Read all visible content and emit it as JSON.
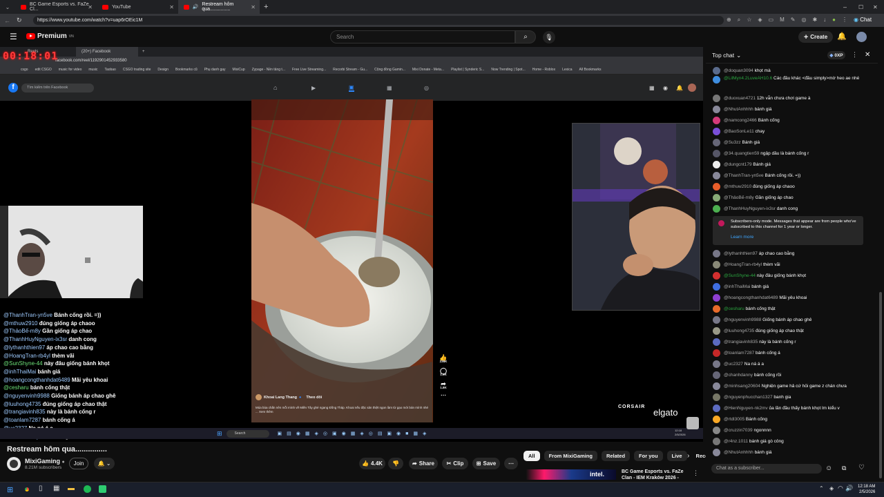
{
  "browser": {
    "tabs": [
      {
        "label": "BC Game Esports vs. FaZe Cl...",
        "active": false
      },
      {
        "label": "YouTube",
        "active": false
      },
      {
        "label": "Restream hôm qua...............",
        "active": true
      }
    ],
    "url": "https://www.youtube.com/watch?v=uap6rOEic1M",
    "chat_ext": "Chat"
  },
  "header": {
    "logo": "Premium",
    "logo_sup": "VN",
    "search_placeholder": "Search",
    "create_label": "Create"
  },
  "stream": {
    "timer": "00:18:01",
    "fb_tab1": "Reels",
    "fb_tab2": "(20+) Facebook",
    "fb_url": "facebook.com/reel/1192901452933580",
    "fb_search": "Tìm kiếm trên Facebook",
    "bookmarks": [
      "csgo",
      "edit CSGO",
      "music for video",
      "music",
      "Taobao",
      "CSGO trading site",
      "Design",
      "Bookmarks cũ",
      "Phụ danh gay",
      "MixiCup",
      "Zypage - Nền tảng t...",
      "Free Live Streaming...",
      "Recorbi Stream - Gu...",
      "Cộng đồng Gamin...",
      "Mixi Donate - Meta...",
      "Playlist | Synderic S...",
      "Now Trending | Spot...",
      "Home - Roblox",
      "Lexica",
      "All Bookmarks"
    ],
    "reel_author": "Khoai Lang Thang",
    "reel_follow": "Theo dõi",
    "reel_caption": "Múa bùa chấn nên mỗi mình về Miền Tây ghé ngang Đồng Tháp. Khoai nếu đặc sản thiệt ngon làm từ gạo mới bán mình nhé ... Xem thêm",
    "reel_likes": "236K",
    "reel_comments": "1.9K",
    "reel_shares": "1.8K",
    "corsair": "CORSAIR",
    "elgato": "elgato",
    "inner_search": "Search",
    "inner_clock_time": "12:18",
    "inner_clock_date": "2/5/2026",
    "overlay_chat": [
      {
        "user": "@ThanhTran-yn5ve",
        "msg": "Bánh cống rồi. =))",
        "green": false
      },
      {
        "user": "@mthuw2910",
        "msg": "đúng giống áp chaoo",
        "green": false
      },
      {
        "user": "@ThảoBế-m8y",
        "msg": "Gần giống áp chao",
        "green": false
      },
      {
        "user": "@ThanhHuyNguyen-ix3sr",
        "msg": "danh cong",
        "green": false
      },
      {
        "user": "@lythanhthien97",
        "msg": "áp chao cao bằng",
        "green": false
      },
      {
        "user": "@HoangTran-rb4yl",
        "msg": "thèm vãi",
        "green": false
      },
      {
        "user": "@SunShyne-44",
        "msg": "này đâu giống bánh khọt",
        "green": true
      },
      {
        "user": "@inhThaiMai",
        "msg": "bánh giá",
        "green": false
      },
      {
        "user": "@hoangcongthanhdat6489",
        "msg": "Mãi yêu khoai",
        "green": false
      },
      {
        "user": "@cesharu",
        "msg": "bánh cống thật",
        "green": true
      },
      {
        "user": "@nguyenvinh9988",
        "msg": "Giống bánh áp chao ghê",
        "green": false
      },
      {
        "user": "@luuhong4735",
        "msg": "đúng giống áp chao thật",
        "green": false
      },
      {
        "user": "@trangiavinh835",
        "msg": "này là bánh cống r",
        "green": false
      },
      {
        "user": "@toanlam7287",
        "msg": "bánh cống á",
        "green": false
      },
      {
        "user": "@uc2327",
        "msg": "Na ná á a",
        "green": false
      },
      {
        "user": "@chanhdanny",
        "msg": "bánh cống rồi",
        "green": false
      }
    ]
  },
  "video": {
    "title": "Restream hôm qua...............",
    "channel": "MixiGaming",
    "subscribers": "8.21M subscribers",
    "join": "Join",
    "likes": "4.4K",
    "share": "Share",
    "clip": "Clip",
    "save": "Save",
    "chips": [
      "All",
      "From MixiGaming",
      "Related",
      "For you",
      "Live",
      "Rece"
    ],
    "rec_title": "BC Game Esports vs. FaZe Clan - IEM Kraków 2026 -"
  },
  "chat": {
    "header": "Top chat",
    "points": "0XP",
    "input_placeholder": "Chat as a subscriber...",
    "notice_text": "Subscribers-only mode. Messages that appear are from people who've subscribed to this channel for 1 year or longer.",
    "notice_link": "Learn more",
    "messages_top": [
      {
        "user": "@doquan3094",
        "msg": "khọt mà",
        "color": "#5a6b8c",
        "member": false
      },
      {
        "user": "@LilMyn4.2LuveAH10.6",
        "msg": "Các đầu khác <đầu simply>mờ heo ae nhé",
        "color": "#3f8ee0",
        "member": true
      },
      {
        "user": "@duoxuan4721",
        "msg": "12h vẫn chưa chơi game à",
        "color": "#777",
        "member": false
      },
      {
        "user": "@NhutAnhhhh",
        "msg": "bánh giá",
        "color": "#889",
        "member": false
      },
      {
        "user": "@namcong2466",
        "msg": "Bánh cống",
        "color": "#d33a7a",
        "member": false
      },
      {
        "user": "@BaoSonLe11",
        "msg": "chay",
        "color": "#7a4fd9",
        "member": false
      },
      {
        "user": "@Su3zz",
        "msg": "Bánh giá",
        "color": "#667",
        "member": false
      },
      {
        "user": "@34.quangtien59",
        "msg": "ngập dầu là bánh cống r",
        "color": "#556",
        "member": false
      },
      {
        "user": "@dungcnt179",
        "msg": "Bánh giá",
        "color": "#eee",
        "member": false
      },
      {
        "user": "@ThanhTran-yn5ve",
        "msg": "Bánh cống rồi. =))",
        "color": "#889",
        "member": false
      },
      {
        "user": "@mthuw2910",
        "msg": "đúng giống áp chaoo",
        "color": "#e85d2a",
        "member": false
      },
      {
        "user": "@ThảoBế-m8y",
        "msg": "Gần giống áp chao",
        "color": "#8a7",
        "member": false
      },
      {
        "user": "@ThanhHuyNguyen-ix3sr",
        "msg": "danh cong",
        "color": "#4caf50",
        "member": false
      }
    ],
    "messages_bottom": [
      {
        "user": "@lythanhthien97",
        "msg": "áp chao cao bằng",
        "color": "#778",
        "member": false
      },
      {
        "user": "@HoangTran-rb4yl",
        "msg": "thèm vãi",
        "color": "#887",
        "member": false
      },
      {
        "user": "@SunShyne-44",
        "msg": "này đâu giống bánh khọt",
        "color": "#d32f2f",
        "member": true
      },
      {
        "user": "@inhThaiMai",
        "msg": "bánh giá",
        "color": "#3f6ee0",
        "member": false
      },
      {
        "user": "@hoangcongthanhdat6489",
        "msg": "Mãi yêu khoai",
        "color": "#8e3fd0",
        "member": false
      },
      {
        "user": "@cesharu",
        "msg": "bánh cống thật",
        "color": "#e86a2a",
        "member": true
      },
      {
        "user": "@nguyenvinh9988",
        "msg": "Giống bánh áp chao ghê",
        "color": "#778",
        "member": false
      },
      {
        "user": "@luuhong4735",
        "msg": "đúng giống áp chao thật",
        "color": "#998",
        "member": false
      },
      {
        "user": "@trangiavinh835",
        "msg": "này là bánh cống r",
        "color": "#5c6bc0",
        "member": false
      },
      {
        "user": "@toanlam7287",
        "msg": "bánh cống á",
        "color": "#c62828",
        "member": false
      },
      {
        "user": "@uc2327",
        "msg": "Na ná á a",
        "color": "#778",
        "member": false
      },
      {
        "user": "@chanhdanny",
        "msg": "bánh cống rồi",
        "color": "#667",
        "member": false
      },
      {
        "user": "@minhsang20604",
        "msg": "Nghiện game hả cứ hỏi game z chán chưa",
        "color": "#889",
        "member": false
      },
      {
        "user": "@nguyenphucchan1327",
        "msg": "banh gia",
        "color": "#776",
        "member": false
      },
      {
        "user": "@HienNguyen-nk2mv",
        "msg": "ủa lần đầu thấy bánh khọt lm kiểu v",
        "color": "#5c6bc0",
        "member": false
      },
      {
        "user": "@rtdl3005",
        "msg": "Bánh cống",
        "color": "#f9a825",
        "member": false
      },
      {
        "user": "@cruzzin7039",
        "msg": "ngonnnn",
        "color": "#888",
        "member": false
      },
      {
        "user": "@r4nz.1011",
        "msg": "bánh giá gò công",
        "color": "#777",
        "member": false
      },
      {
        "user": "@NhutAnhhhh",
        "msg": "bánh giá",
        "color": "#889",
        "member": false
      }
    ]
  },
  "taskbar": {
    "time": "12:18 AM",
    "date": "2/5/2026"
  }
}
